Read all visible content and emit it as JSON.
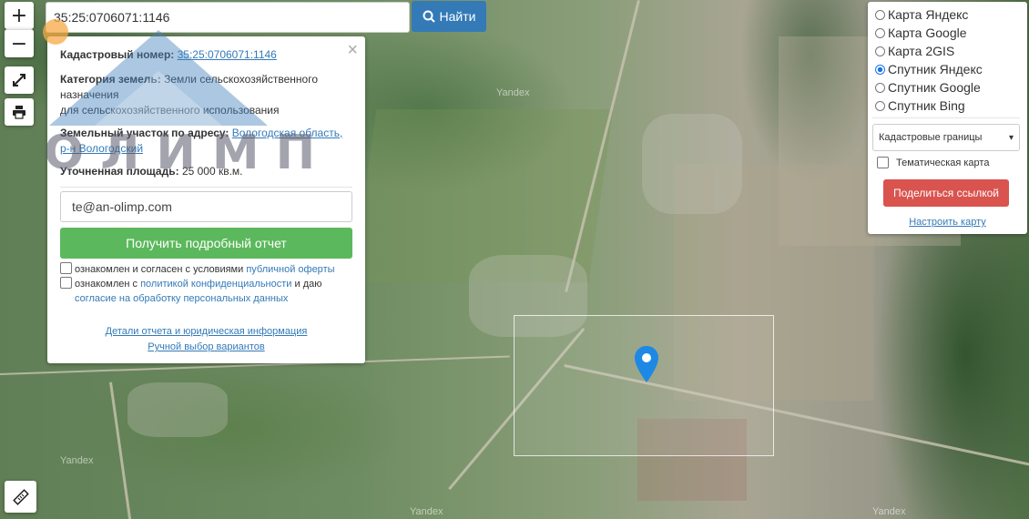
{
  "search": {
    "value": "35:25:0706071:1146",
    "button_label": "Найти"
  },
  "zoom": {
    "in": "+",
    "out": "−"
  },
  "info": {
    "cadastral_label": "Кадастровый номер:",
    "cadastral_value": "35:25:0706071:1146",
    "category_label": "Категория земель:",
    "category_value": "Земли сельскохозяйственного назначения",
    "category_value2": "для сельскохозяйственного использования",
    "address_label": "Земельный участок по адресу:",
    "address_value": "Вологодская область, р-н Вологодский",
    "area_label": "Уточненная площадь:",
    "area_value": "25 000 кв.м.",
    "close": "×",
    "email_value": "te@an-olimp.com",
    "report_button": "Получить подробный отчет",
    "agree1_text": "ознакомлен и согласен с условиями",
    "agree1_link": "публичной оферты",
    "agree2_text": "ознакомлен с",
    "agree2_link": "политикой конфиденциальности",
    "agree2_text2": "и даю",
    "agree2_link2": "согласие на обработку персональных данных",
    "details_link": "Детали отчета и юридическая информация",
    "manual_link": "Ручной выбор вариантов"
  },
  "layers": {
    "options": [
      "Карта Яндекс",
      "Карта Google",
      "Карта 2GIS",
      "Спутник Яндекс",
      "Спутник Google",
      "Спутник Bing"
    ],
    "selected": "Спутник Яндекс",
    "select_value": "Кадастровые границы",
    "thematic_label": "Тематическая карта",
    "share_button": "Поделиться ссылкой",
    "setup_link": "Настроить карту"
  },
  "watermark": {
    "logo_text": "ОЛИМП",
    "map_brand": "Yandex"
  },
  "colors": {
    "accent_blue": "#337ab7",
    "green_btn": "#5cb85c",
    "red_btn": "#d9534f",
    "marker": "#1e88e5"
  }
}
